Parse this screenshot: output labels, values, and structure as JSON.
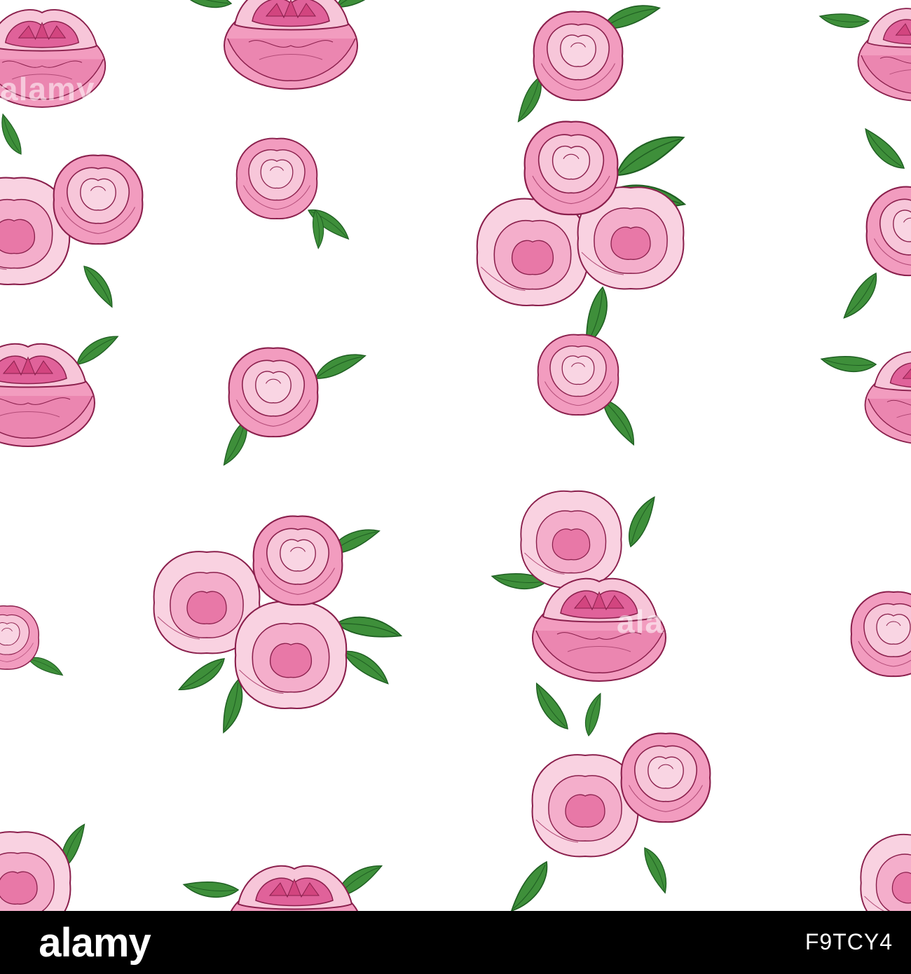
{
  "image": {
    "description_hidden": true,
    "background_color": "#ffffff",
    "petal_light": "#f7c6d9",
    "petal_mid": "#f29cbf",
    "petal_deep": "#e0629a",
    "outline": "#8a1f4c",
    "leaf_color": "#3e8f3a",
    "leaf_dark": "#1f5f22"
  },
  "watermark": {
    "text": "alamy"
  },
  "footer": {
    "logo_text": "alamy",
    "image_id": "F9TCY4",
    "background_color": "#000000",
    "text_color": "#ffffff"
  }
}
